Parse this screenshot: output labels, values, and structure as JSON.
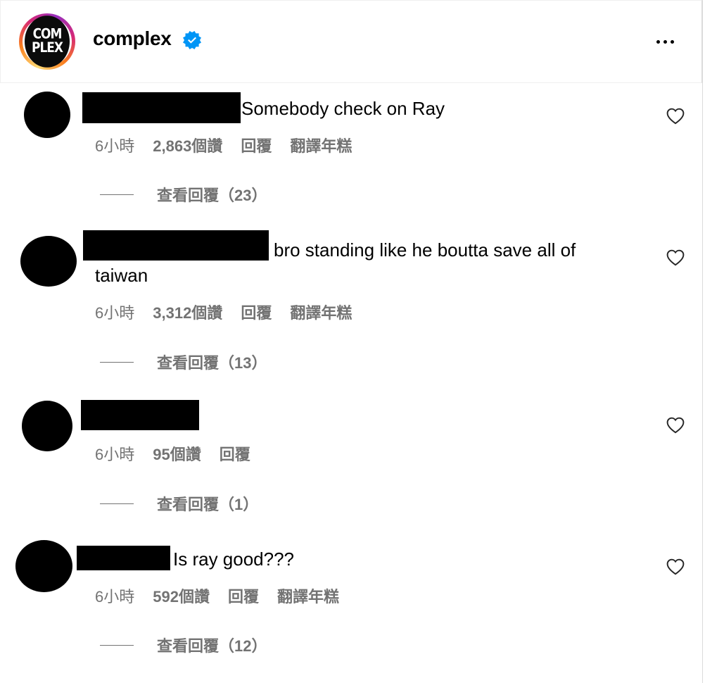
{
  "header": {
    "username": "complex",
    "avatar_logo_lines": [
      "COM",
      "PLEX"
    ],
    "verified_color": "#0095f6"
  },
  "comments": [
    {
      "text": "Somebody check on Ray",
      "time": "6小時",
      "likes": "2,863個讚",
      "reply": "回覆",
      "translate": "翻譯年糕",
      "view_replies": "查看回覆（23）"
    },
    {
      "text_line1": "bro standing like he boutta save all of",
      "text_line2": "taiwan",
      "time": "6小時",
      "likes": "3,312個讚",
      "reply": "回覆",
      "translate": "翻譯年糕",
      "view_replies": "查看回覆（13）"
    },
    {
      "text": "",
      "time": "6小時",
      "likes": "95個讚",
      "reply": "回覆",
      "view_replies": "查看回覆（1）"
    },
    {
      "text": "Is ray good???",
      "time": "6小時",
      "likes": "592個讚",
      "reply": "回覆",
      "translate": "翻譯年糕",
      "view_replies": "查看回覆（12）"
    }
  ],
  "colors": {
    "secondary_text": "#737373",
    "border": "#dbdbdb"
  },
  "icons": [
    "verified-badge-icon",
    "more-options-icon",
    "heart-icon"
  ]
}
